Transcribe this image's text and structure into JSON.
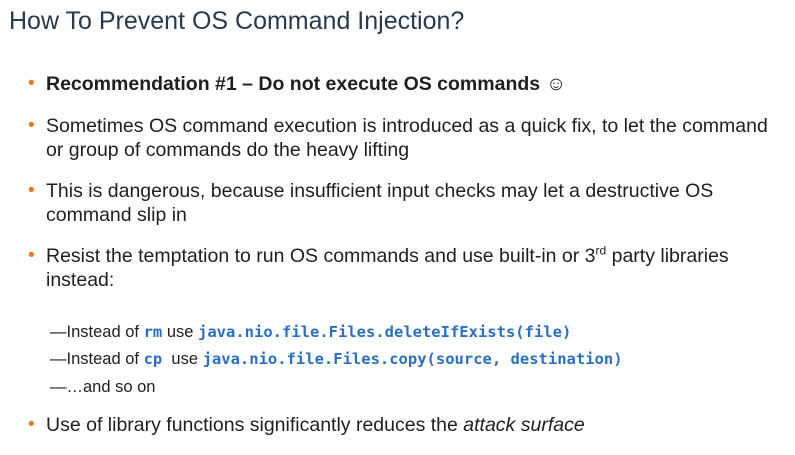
{
  "title": "How To Prevent OS Command Injection?",
  "bullets": {
    "b1": {
      "text": "Recommendation #1 – Do not execute OS commands",
      "smiley": "☺"
    },
    "b2": {
      "text": "Sometimes OS command execution is introduced as a quick fix, to let the command or group of commands do the heavy lifting"
    },
    "b3": {
      "text": "This is dangerous, because insufficient input checks may let a destructive OS command slip in"
    },
    "b4": {
      "pre": "Resist the temptation to run OS commands and use built-in or 3",
      "sup": "rd",
      "post": " party libraries instead:"
    },
    "b5": {
      "pre": "Use of library functions significantly reduces the ",
      "italic": "attack surface"
    }
  },
  "subitems": {
    "s1": {
      "dash": "—",
      "pre": "Instead of ",
      "cmd": "rm",
      "mid": " use ",
      "code": "java.nio.file.Files.deleteIfExists(file)"
    },
    "s2": {
      "dash": "—",
      "pre": "Instead of ",
      "cmd": "cp",
      "mid": "  use ",
      "code": "java.nio.file.Files.copy(source, destination)"
    },
    "s3": {
      "dash": "—",
      "text": "…and so on"
    }
  },
  "bullet_glyph": "•",
  "colors": {
    "bullet": "#e87722",
    "code": "#2a6fc4",
    "title": "#2b3a4a"
  }
}
